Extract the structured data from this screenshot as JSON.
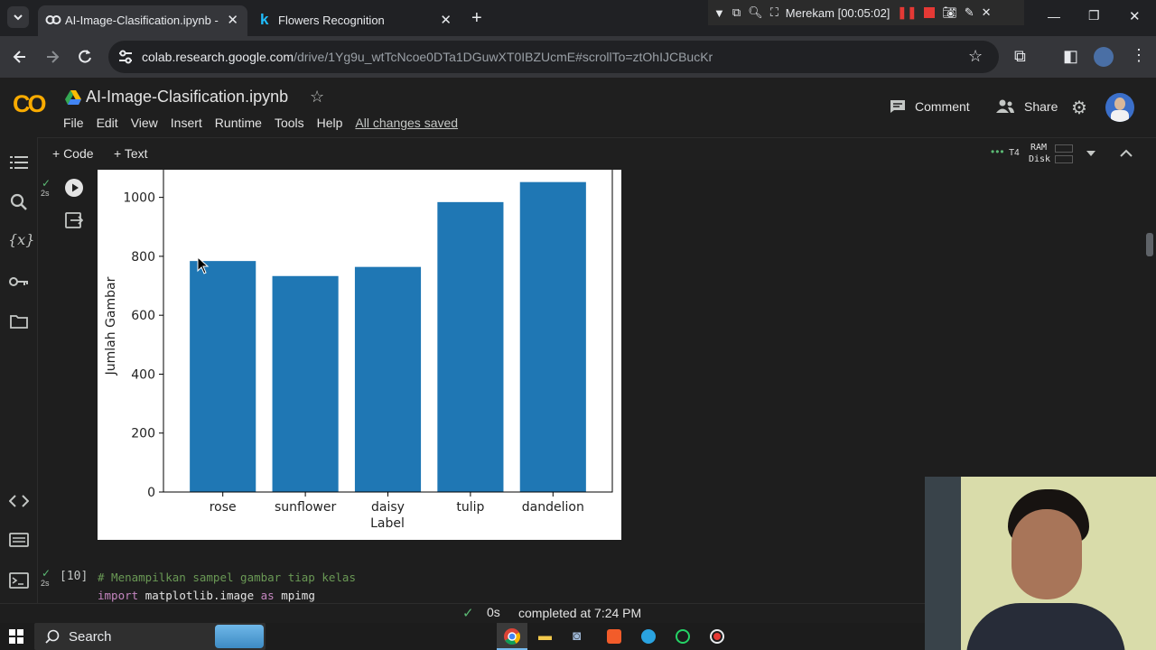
{
  "browser": {
    "tabs": [
      {
        "title": "AI-Image-Clasification.ipynb - C",
        "active": true
      },
      {
        "title": "Flowers Recognition",
        "active": false
      }
    ],
    "recorder_label": "Merekam [00:05:02]",
    "url_host": "colab.research.google.com",
    "url_path": "/drive/1Yg9u_wtTcNcoe0DTa1DGuwXT0IBZUcmE#scrollTo=ztOhIJCBucKr"
  },
  "colab": {
    "logo_text": "CO",
    "notebook_title": "AI-Image-Clasification.ipynb",
    "menu": [
      "File",
      "Edit",
      "View",
      "Insert",
      "Runtime",
      "Tools",
      "Help"
    ],
    "saved_status": "All changes saved",
    "comment_label": "Comment",
    "share_label": "Share",
    "add_code_label": "+ Code",
    "add_text_label": "+ Text",
    "runtime_type": "T4",
    "ram_label": "RAM",
    "disk_label": "Disk"
  },
  "cell_output": {
    "exec_time": "2s"
  },
  "chart_data": {
    "type": "bar",
    "categories": [
      "rose",
      "sunflower",
      "daisy",
      "tulip",
      "dandelion"
    ],
    "values": [
      784,
      733,
      764,
      984,
      1052
    ],
    "xlabel": "Label",
    "ylabel": "Jumlah Gambar",
    "yticks": [
      0,
      200,
      400,
      600,
      800,
      1000
    ],
    "ylim": [
      0,
      1100
    ],
    "bar_color": "#1f77b4"
  },
  "code_cell": {
    "exec_count": "[10]",
    "exec_time": "2s",
    "comment_line": "# Menampilkan sampel gambar tiap kelas",
    "import_kw": "import",
    "import_module": "matplotlib.image",
    "as_kw": "as",
    "import_alias": "mpimg"
  },
  "status": {
    "time": "0s",
    "text": "completed at 7:24 PM"
  },
  "taskbar": {
    "search_placeholder": "Search"
  },
  "colors": {
    "accent_orange": "#f9ab00",
    "check_green": "#5bb974",
    "bar_blue": "#1f77b4"
  }
}
